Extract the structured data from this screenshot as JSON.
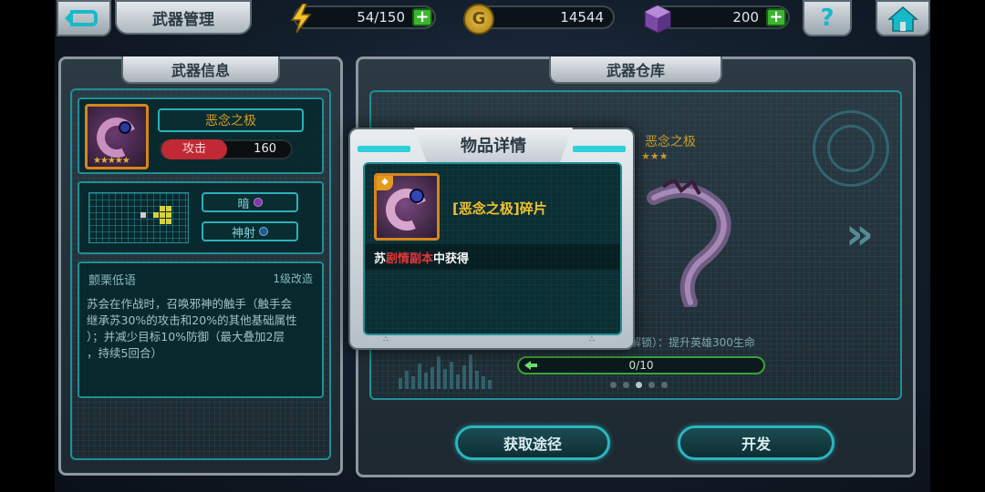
{
  "header": {
    "title": "武器管理",
    "energy": "54/150",
    "coins": "14544",
    "gems": "200",
    "plus": "+",
    "help": "?"
  },
  "left_panel": {
    "title": "武器信息",
    "weapon_name": "恶念之极",
    "stars": "★★★★★",
    "attack_label": "攻击",
    "attack_value": "160",
    "tag_dark": "暗",
    "tag_shot": "神射",
    "skill_name": "颤栗低语",
    "skill_level": "1级改造",
    "skill_desc_1": "苏会在作战时，召唤邪神的触手（触手会",
    "skill_desc_2": "继承苏30%的攻击和20%的其他基础属性",
    "skill_desc_3": "）；并减少目标10%防御（最大叠加2层",
    "skill_desc_4": "，持续5回合）"
  },
  "right_panel": {
    "title": "武器仓库",
    "bg_name": "恶念之极",
    "bg_stars": "★★★",
    "unlock_text": "解锁）：提升英雄300生命",
    "progress_text": "0/10",
    "progress_fraction": 0.0,
    "btn_obtain": "获取途径",
    "btn_develop": "开发"
  },
  "modal": {
    "title": "物品详情",
    "item_name": "[恶念之极]碎片",
    "source_prefix": "苏",
    "source_highlight": "剧情副本",
    "source_suffix": "中获得"
  },
  "colors": {
    "accent_teal": "#2bb6c0",
    "attack_red": "#c12a34",
    "gold_text": "#f2c12e",
    "highlight_red": "#e3363b",
    "progress_green": "#3aa23a"
  }
}
